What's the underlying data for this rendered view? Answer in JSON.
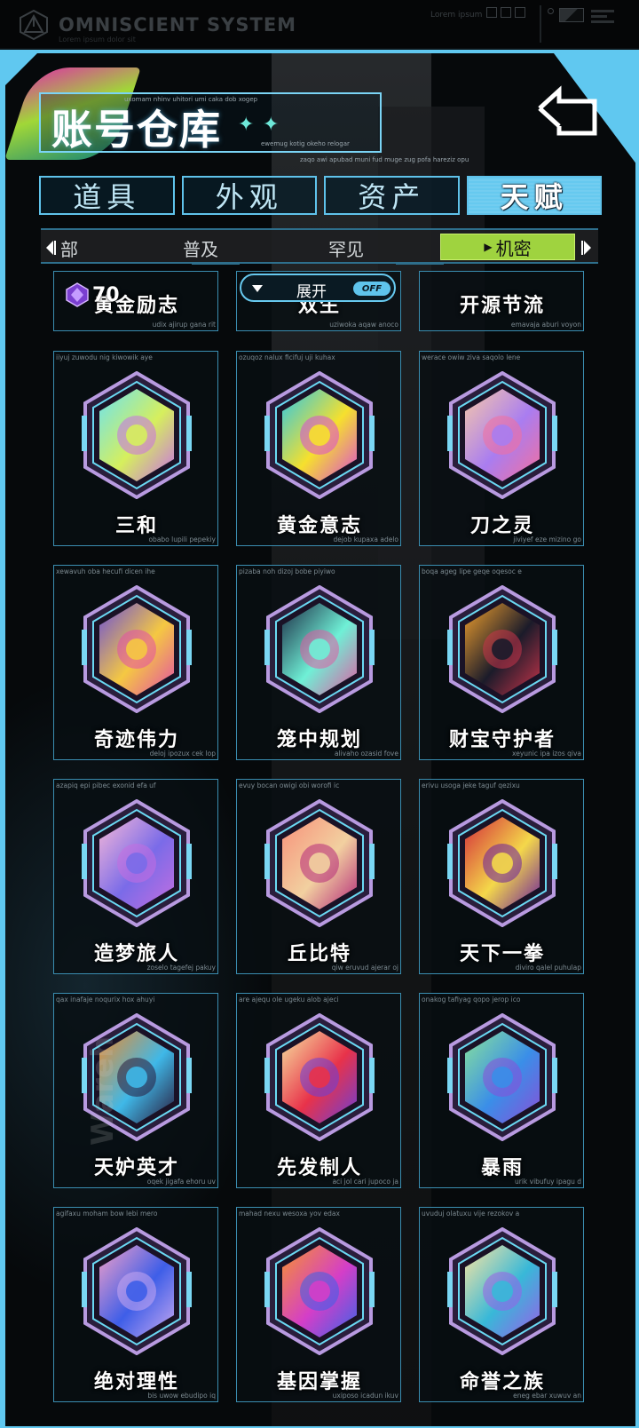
{
  "system": {
    "title": "OMNISCIENT  SYSTEM",
    "subtitle": "Lorem ipsum dolor sit",
    "lorem": "Lorem ipsum"
  },
  "header": {
    "title": "账号仓库",
    "tag1": "uxomam nhinv uhitori umi caka dob xogep",
    "tag2": "ewemug kotig okeho relogar",
    "tag3": "zaqo awi apubad muni fud muge zug pofa hareziz opu"
  },
  "tabs": [
    {
      "label": "道具"
    },
    {
      "label": "外观"
    },
    {
      "label": "资产"
    },
    {
      "label": "天赋"
    }
  ],
  "subtabs": {
    "all": "部",
    "common": "普及",
    "rare": "罕见",
    "secret": "机密"
  },
  "counter": {
    "value": "70"
  },
  "expand": {
    "label": "展开",
    "toggle": "OFF"
  },
  "partial_row": [
    {
      "name": "黄金励志",
      "tag2": "udix ajirup gana rit"
    },
    {
      "name": "双生",
      "tag2": "uziwoka aqaw anoco"
    },
    {
      "name": "开源节流",
      "tag2": "emavaja aburi voyon"
    }
  ],
  "cards": [
    {
      "name": "三和",
      "tag": "iiyuj zuwodu nig kiwowik aye",
      "tag2": "obabo lupili pepekiy",
      "colors": [
        "#6be3f2",
        "#d6ef5d",
        "#c86ee8"
      ]
    },
    {
      "name": "黄金意志",
      "tag": "ozuqoz nalux ficifuj uji kuhax",
      "tag2": "dejob kupaxa adelo",
      "colors": [
        "#2bc7e8",
        "#f6e02d",
        "#d94bd6"
      ]
    },
    {
      "name": "刀之灵",
      "tag": "werace owiw ziva saqolo lene",
      "tag2": "jiviyef eze mizino go",
      "colors": [
        "#f7c9a8",
        "#a97df0",
        "#f46f9d"
      ]
    },
    {
      "name": "奇迹伟力",
      "tag": "xewavuh oba hecufi dicen ihe",
      "tag2": "deloj ipozux cek lop",
      "colors": [
        "#6b4fd8",
        "#f5c842",
        "#e24ea8"
      ]
    },
    {
      "name": "笼中规划",
      "tag": "pizaba noh dizoj bobe piyiwo",
      "tag2": "alivaho ozasid fove",
      "colors": [
        "#1c2a44",
        "#6ff0d6",
        "#e05ba2"
      ]
    },
    {
      "name": "财宝守护者",
      "tag": "boqa ageg lipe geqe oqesoc e",
      "tag2": "xeyunic ipa izos qiva",
      "colors": [
        "#f2a12e",
        "#1b1b2a",
        "#c9344a"
      ]
    },
    {
      "name": "造梦旅人",
      "tag": "azapiq epi pibec exonid efa uf",
      "tag2": "zoselo tagefej pakuy",
      "colors": [
        "#f6b8d8",
        "#7a6be8",
        "#c46ee0"
      ]
    },
    {
      "name": "丘比特",
      "tag": "evuy bocan owigi obi worofi ic",
      "tag2": "qiw eruvud ajerar oj",
      "colors": [
        "#f7907a",
        "#f2d0a0",
        "#b4297a"
      ]
    },
    {
      "name": "天下一拳",
      "tag": "erivu usoga jeke taguf qezixu",
      "tag2": "diviro qalel puhulap",
      "colors": [
        "#d42a3a",
        "#f4d84a",
        "#6a1f9e"
      ]
    },
    {
      "name": "天妒英才",
      "tag": "qax inafaje noqurix hox ahuyi",
      "tag2": "oqek jigafa ehoru uv",
      "colors": [
        "#f08a2a",
        "#3fb8e8",
        "#2a1a3a"
      ]
    },
    {
      "name": "先发制人",
      "tag": "are ajequ ole ugeku alob ajeci",
      "tag2": "aci jol cari jupoco ja",
      "colors": [
        "#f7e4a0",
        "#e8324a",
        "#6a3fd8"
      ]
    },
    {
      "name": "暴雨",
      "tag": "onakog tafiyag qopo jerop ico",
      "tag2": "urik vibufuy ipagu d",
      "colors": [
        "#89e39a",
        "#3a8ee8",
        "#8a4fd8"
      ]
    },
    {
      "name": "绝对理性",
      "tag": "agifaxu moham bow lebi mero",
      "tag2": "bis uwow ebudipo iq",
      "colors": [
        "#f4a0c8",
        "#3e5ee8",
        "#c9a8f0"
      ]
    },
    {
      "name": "基因掌握",
      "tag": "mahad nexu wesoxa yov edax",
      "tag2": "uxiposo icadun ikuv",
      "colors": [
        "#f7932e",
        "#d43ec8",
        "#3b63e8"
      ]
    },
    {
      "name": "命誉之族",
      "tag": "uvuduj olatuxu vije rezokov a",
      "tag2": "eneg ebar xuwuv an",
      "colors": [
        "#ffe6a0",
        "#38b8d8",
        "#9a5ee8"
      ]
    }
  ],
  "watermark": "Wareh"
}
